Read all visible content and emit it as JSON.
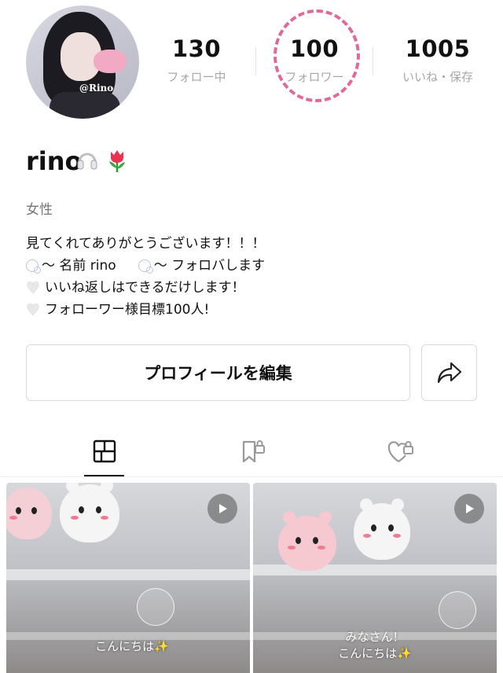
{
  "profile": {
    "avatar_tag": "@Rino",
    "username": "rino",
    "username_emoji": [
      "headphones",
      "tulip"
    ],
    "gender": "女性",
    "bio_lines": [
      "見てくれてありがとうございます！！！",
      "〜 名前 rino",
      "〜 フォロバします",
      "いいね返しはできるだけします！",
      "フォローワー様目標100人!"
    ]
  },
  "stats": {
    "following": {
      "value": "130",
      "label": "フォロー中"
    },
    "followers": {
      "value": "100",
      "label": "フォロワー"
    },
    "likes": {
      "value": "1005",
      "label": "いいね・保存"
    }
  },
  "buttons": {
    "edit_profile": "プロフィールを編集"
  },
  "tabs": [
    {
      "name": "posts",
      "icon": "grid-icon",
      "selected": true
    },
    {
      "name": "saved",
      "icon": "bookmark-lock-icon",
      "selected": false
    },
    {
      "name": "liked",
      "icon": "heart-lock-icon",
      "selected": false
    }
  ],
  "posts": [
    {
      "caption": "こんにちは✨"
    },
    {
      "caption_line1": "みなさん！",
      "caption_line2": "こんにちは✨"
    }
  ],
  "colors": {
    "highlight_circle": "#e0699b",
    "stat_label": "#a7a7a7"
  }
}
